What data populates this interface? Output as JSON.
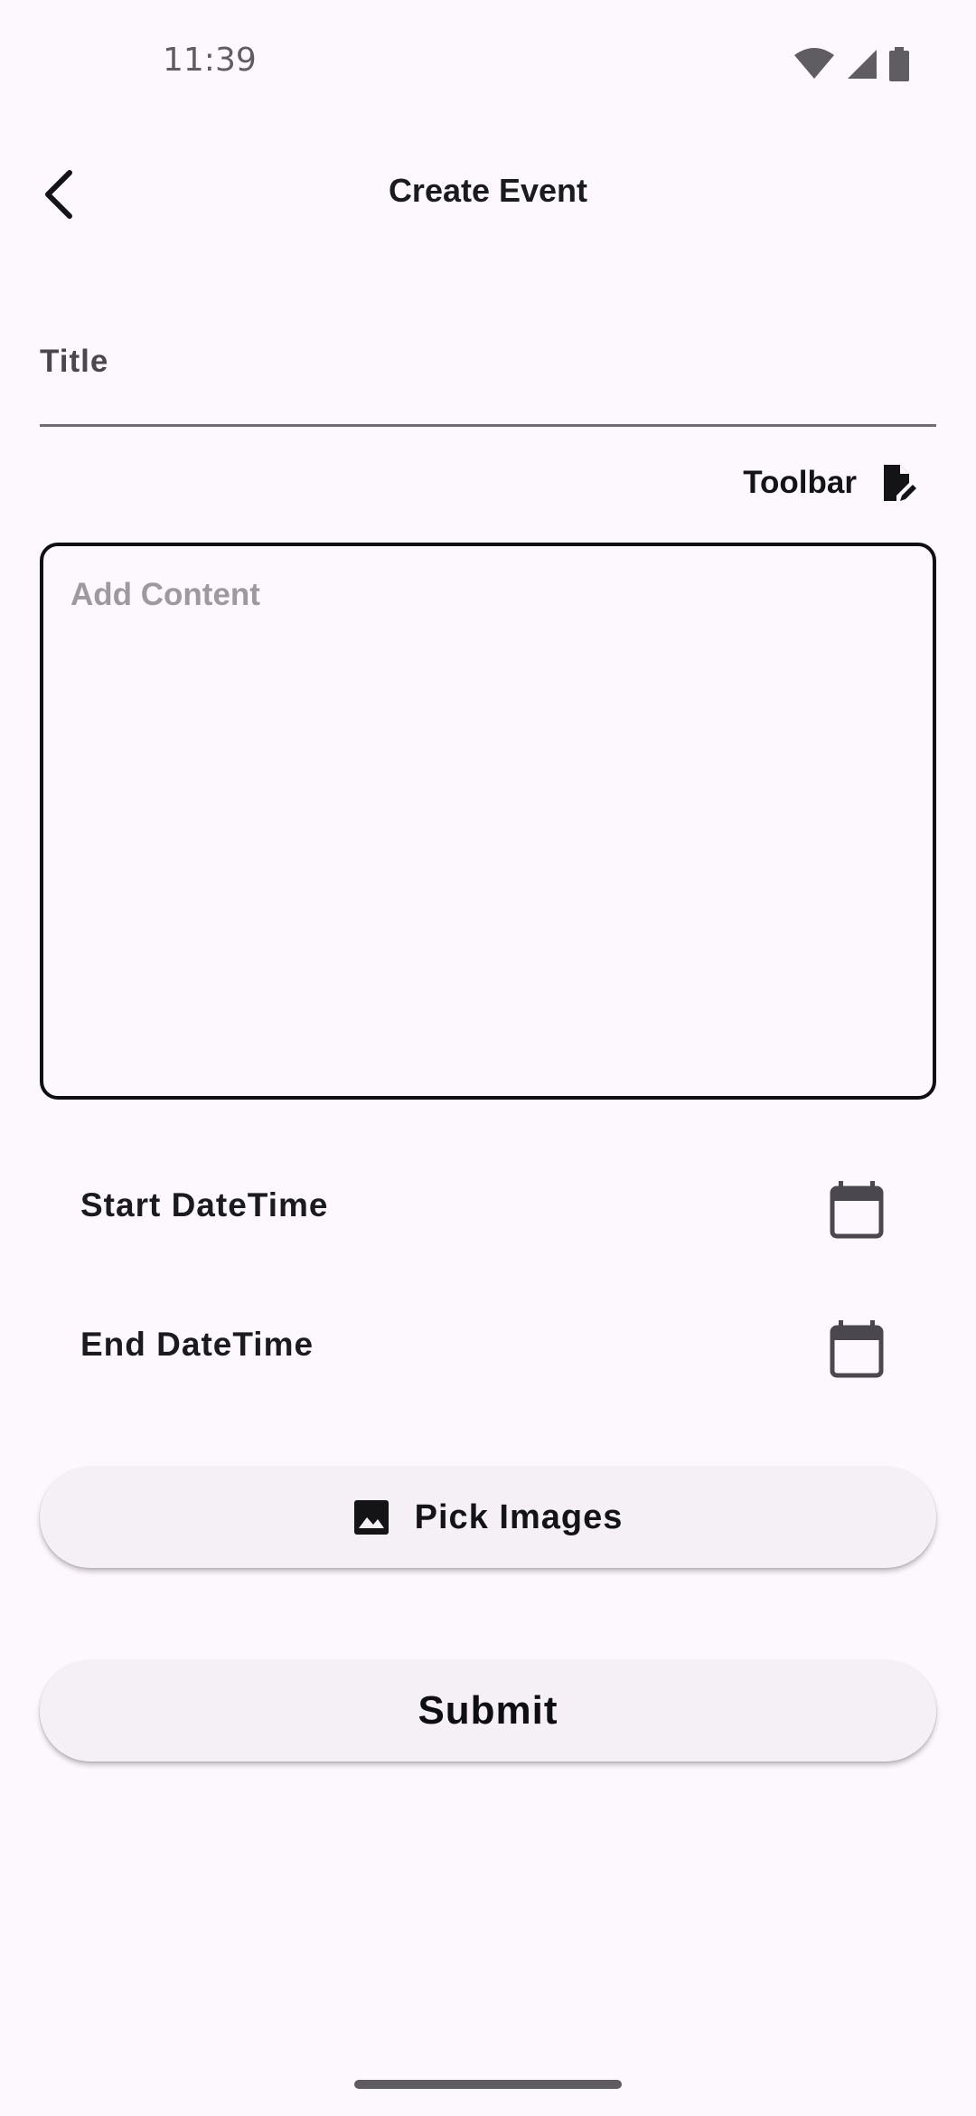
{
  "status_bar": {
    "time": "11:39",
    "icons": [
      "wifi-icon",
      "signal-icon",
      "battery-icon"
    ]
  },
  "app_bar": {
    "title": "Create Event",
    "back_icon": "back-arrow-icon"
  },
  "form": {
    "title_placeholder": "Title",
    "toolbar_label": "Toolbar",
    "toolbar_icon": "edit-document-icon",
    "content_placeholder": "Add Content",
    "start_label": "Start DateTime",
    "end_label": "End DateTime",
    "calendar_icon": "calendar-icon"
  },
  "buttons": {
    "pick_images_label": "Pick Images",
    "pick_images_icon": "image-icon",
    "submit_label": "Submit"
  },
  "colors": {
    "background": "#fdf8fd",
    "button_bg": "#f5f0f6",
    "text": "#1b1b1f",
    "placeholder": "#9c9a9e"
  }
}
